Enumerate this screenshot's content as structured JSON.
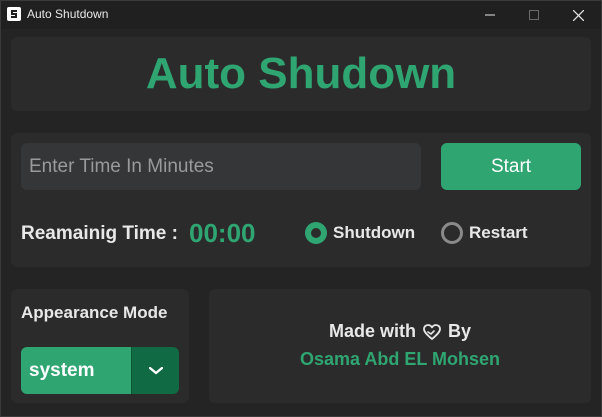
{
  "window": {
    "title": "Auto Shutdown",
    "icon": "app-logo-icon",
    "controls": [
      "minimize-icon",
      "maximize-icon",
      "close-icon"
    ]
  },
  "header": {
    "title": "Auto Shudown"
  },
  "timer": {
    "input_placeholder": "Enter Time In Minutes",
    "input_value": "",
    "start_label": "Start",
    "remaining_label": "Reamainig Time :",
    "remaining_value": "00:00"
  },
  "action": {
    "options": [
      {
        "label": "Shutdown",
        "selected": true
      },
      {
        "label": "Restart",
        "selected": false
      }
    ]
  },
  "appearance": {
    "title": "Appearance Mode",
    "selected": "system",
    "arrow_icon": "chevron-down-icon"
  },
  "credit": {
    "made_with": "Made with",
    "heart_icon": "heart-icon",
    "by": "By",
    "author": "Osama Abd EL Mohsen"
  },
  "colors": {
    "accent": "#2fa572",
    "accent_dark": "#106a43",
    "panel": "#2b2b2b",
    "background": "#242424"
  }
}
